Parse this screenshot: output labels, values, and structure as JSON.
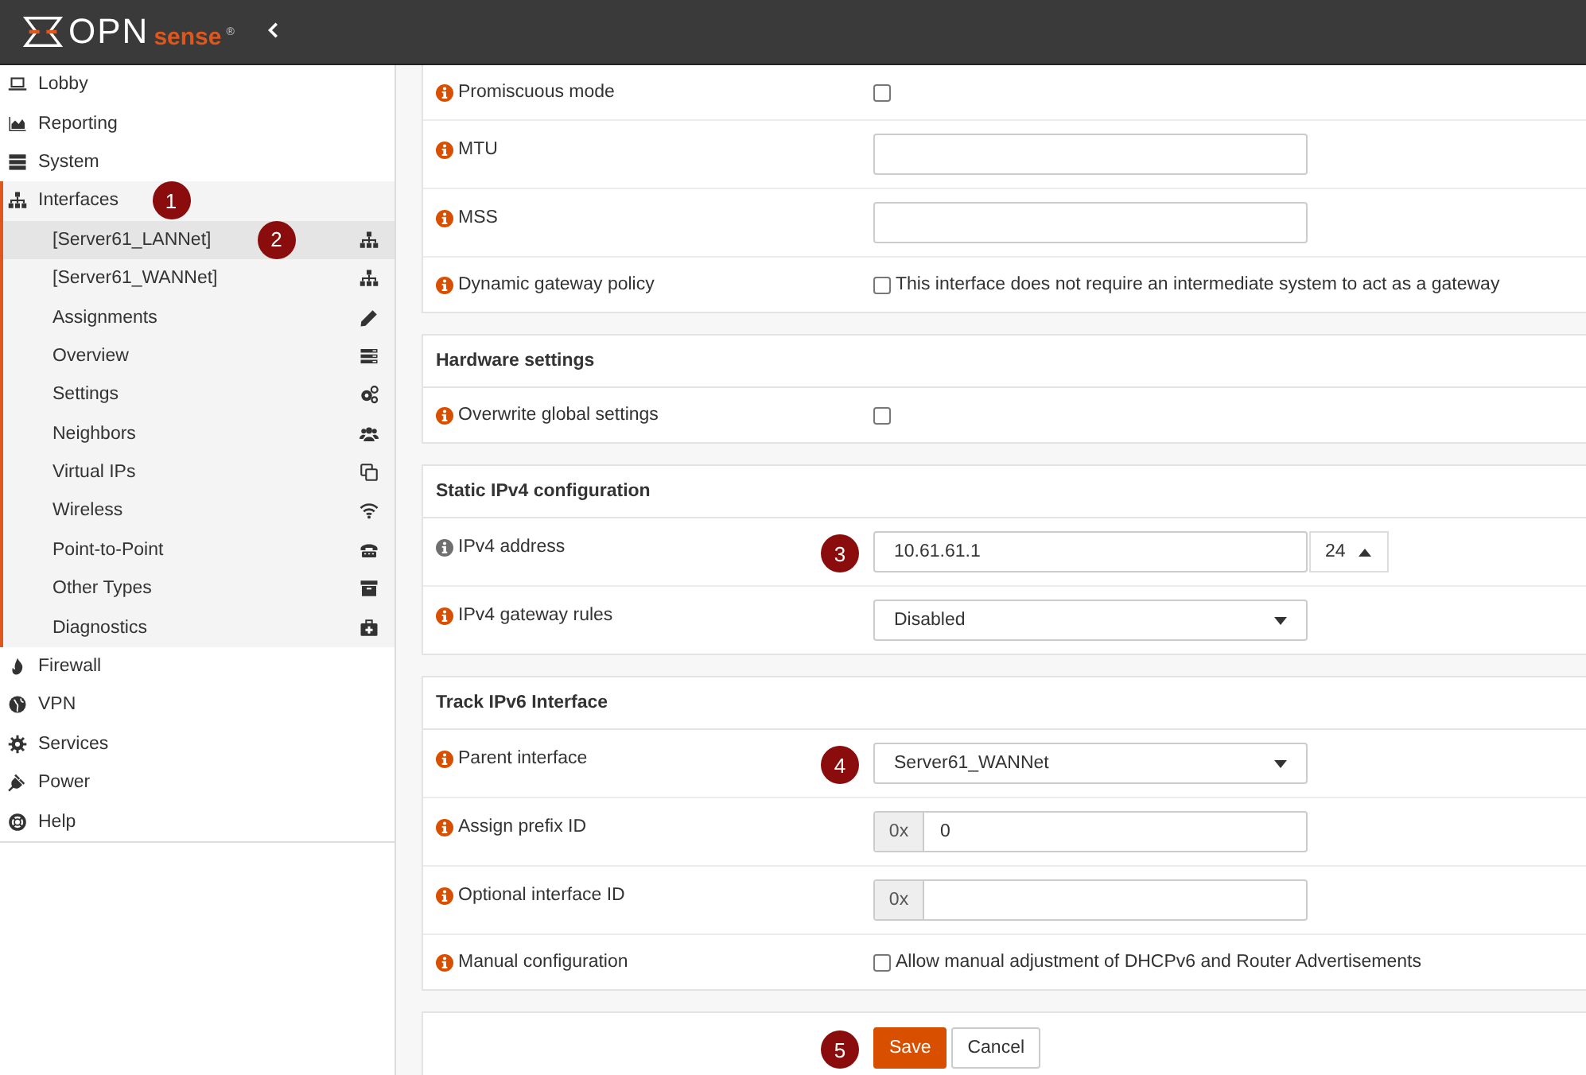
{
  "header": {
    "logo": {
      "primary": "OPN",
      "secondary": "sense",
      "mark": "®"
    }
  },
  "sidebar": {
    "items": [
      {
        "label": "Lobby",
        "expanded": false
      },
      {
        "label": "Reporting",
        "expanded": false
      },
      {
        "label": "System",
        "expanded": false
      },
      {
        "label": "Interfaces",
        "expanded": true,
        "callout": "1",
        "children": [
          {
            "label": "[Server61_LANNet]",
            "selected": true,
            "callout": "2"
          },
          {
            "label": "[Server61_WANNet]",
            "selected": false
          },
          {
            "label": "Assignments",
            "selected": false
          },
          {
            "label": "Overview",
            "selected": false
          },
          {
            "label": "Settings",
            "selected": false
          },
          {
            "label": "Neighbors",
            "selected": false
          },
          {
            "label": "Virtual IPs",
            "selected": false
          },
          {
            "label": "Wireless",
            "selected": false
          },
          {
            "label": "Point-to-Point",
            "selected": false
          },
          {
            "label": "Other Types",
            "selected": false
          },
          {
            "label": "Diagnostics",
            "selected": false
          }
        ]
      },
      {
        "label": "Firewall",
        "expanded": false
      },
      {
        "label": "VPN",
        "expanded": false
      },
      {
        "label": "Services",
        "expanded": false
      },
      {
        "label": "Power",
        "expanded": false
      },
      {
        "label": "Help",
        "expanded": false
      }
    ]
  },
  "panels": [
    {
      "rows": [
        {
          "kind": "checkbox",
          "label": "Promiscuous mode",
          "hovered": false,
          "checked": false
        },
        {
          "kind": "text",
          "label": "MTU",
          "hovered": false
        },
        {
          "kind": "text",
          "label": "MSS",
          "hovered": false
        },
        {
          "kind": "checkbox",
          "label": "Dynamic gateway policy",
          "hovered": false,
          "checked": false,
          "text": "This interface does not require an intermediate system to act as a gateway"
        }
      ]
    },
    {
      "title": "Hardware settings",
      "rows": [
        {
          "kind": "checkbox",
          "label": "Overwrite global settings",
          "hovered": false,
          "checked": false
        }
      ]
    },
    {
      "title": "Static IPv4 configuration",
      "rows": [
        {
          "kind": "address",
          "label": "IPv4 address",
          "hovered": true,
          "value": "10.61.61.1",
          "subnet": "24",
          "callout": "3"
        },
        {
          "kind": "select",
          "label": "IPv4 gateway rules",
          "hovered": false,
          "value": "Disabled"
        }
      ]
    },
    {
      "title": "Track IPv6 Interface",
      "rows": [
        {
          "kind": "select",
          "label": "Parent interface",
          "hovered": false,
          "value": "Server61_WANNet",
          "callout": "4"
        },
        {
          "kind": "prefixed",
          "label": "Assign prefix ID",
          "hovered": false,
          "prefix": "0x",
          "value": "0"
        },
        {
          "kind": "prefixed",
          "label": "Optional interface ID",
          "hovered": false,
          "prefix": "0x"
        },
        {
          "kind": "checkbox",
          "label": "Manual configuration",
          "hovered": false,
          "checked": false,
          "text": "Allow manual adjustment of DHCPv6 and Router Advertisements"
        }
      ]
    }
  ],
  "actions": {
    "callout": "5",
    "buttons": [
      {
        "label": "Save",
        "kind": "primary"
      },
      {
        "label": "Cancel",
        "kind": "default"
      }
    ]
  }
}
